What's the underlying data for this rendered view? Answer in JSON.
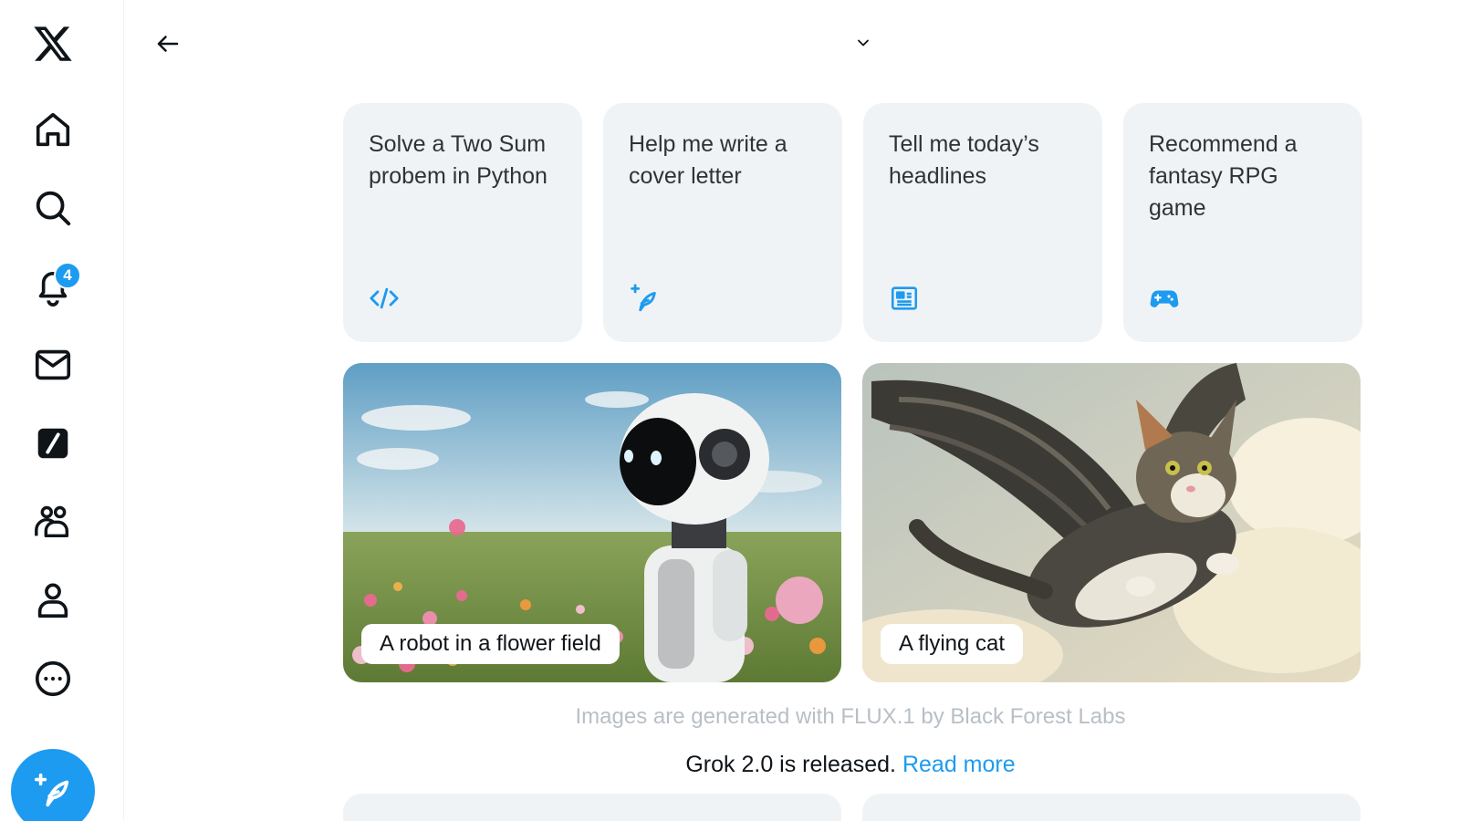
{
  "app": {
    "logo": "x-logo-icon"
  },
  "sidebar": {
    "items": [
      {
        "name": "home",
        "icon": "home-icon"
      },
      {
        "name": "explore",
        "icon": "search-icon"
      },
      {
        "name": "notifications",
        "icon": "bell-icon",
        "badge": "4"
      },
      {
        "name": "messages",
        "icon": "envelope-icon"
      },
      {
        "name": "grok",
        "icon": "grok-icon"
      },
      {
        "name": "communities",
        "icon": "people-icon"
      },
      {
        "name": "profile",
        "icon": "person-icon"
      },
      {
        "name": "more",
        "icon": "more-circle-icon"
      }
    ],
    "post_icon": "feather-plus-icon"
  },
  "header": {
    "back_icon": "arrow-left-icon",
    "model_toggle_icon": "chevron-down-icon"
  },
  "suggestions": [
    {
      "text": "Solve a Two Sum probem in Python",
      "icon": "code-icon"
    },
    {
      "text": "Help me write a cover letter",
      "icon": "feather-plus-icon"
    },
    {
      "text": "Tell me today’s headlines",
      "icon": "newspaper-icon"
    },
    {
      "text": "Recommend a fantasy RPG game",
      "icon": "gamepad-icon"
    }
  ],
  "image_prompts": [
    {
      "label": "A robot in a flower field"
    },
    {
      "label": "A flying cat"
    }
  ],
  "footnote": "Images are generated with FLUX.1 by Black Forest Labs",
  "release": {
    "text": "Grok 2.0 is released. ",
    "link": "Read more"
  },
  "colors": {
    "accent": "#1d9bf0",
    "card_bg": "#f0f3f5",
    "muted_text": "#b8bfc6"
  }
}
